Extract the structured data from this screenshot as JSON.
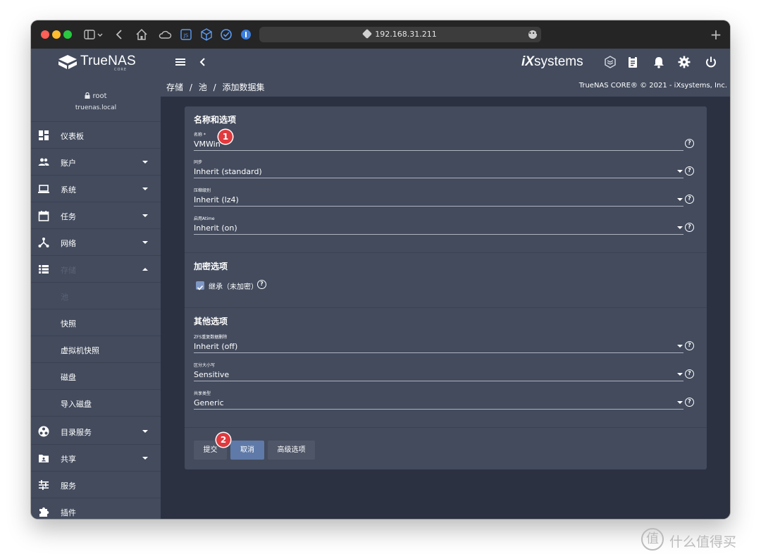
{
  "browser": {
    "address": "192.168.31.211",
    "new_tab": "+"
  },
  "header": {
    "logo_text": "TrueNAS",
    "logo_sub": "CORE",
    "vendor_logo_prefix": "iX",
    "vendor_logo_suffix": "systems"
  },
  "sidebar": {
    "user": "root",
    "host": "truenas.local",
    "items": [
      {
        "label": "仪表板",
        "icon": "dashboard-icon"
      },
      {
        "label": "账户",
        "icon": "people-icon"
      },
      {
        "label": "系统",
        "icon": "laptop-icon"
      },
      {
        "label": "任务",
        "icon": "calendar-icon"
      },
      {
        "label": "网络",
        "icon": "network-icon"
      },
      {
        "label": "存储",
        "icon": "list-icon"
      },
      {
        "label": "池"
      },
      {
        "label": "快照"
      },
      {
        "label": "虚拟机快照"
      },
      {
        "label": "磁盘"
      },
      {
        "label": "导入磁盘"
      },
      {
        "label": "目录服务",
        "icon": "directory-icon"
      },
      {
        "label": "共享",
        "icon": "folder-share-icon"
      },
      {
        "label": "服务",
        "icon": "sliders-icon"
      },
      {
        "label": "插件",
        "icon": "puzzle-icon"
      }
    ]
  },
  "breadcrumb": {
    "level1": "存储",
    "level2": "池",
    "level3": "添加数据集",
    "sep": "/"
  },
  "copyright": "TrueNAS CORE® © 2021 - iXsystems, Inc.",
  "form": {
    "section1_title": "名称和选项",
    "name_label": "名称 *",
    "name_value": "VMWin",
    "sync_label": "同步",
    "sync_value": "Inherit (standard)",
    "compression_label": "压缩级别",
    "compression_value": "Inherit (lz4)",
    "atime_label": "启用Atime",
    "atime_value": "Inherit (on)",
    "section2_title": "加密选项",
    "encryption_checkbox_label": "继承（未加密）",
    "encryption_checked": true,
    "section3_title": "其他选项",
    "dedup_label": "ZFS重复数据删除",
    "dedup_value": "Inherit (off)",
    "case_label": "区分大小写",
    "case_value": "Sensitive",
    "share_label": "共享类型",
    "share_value": "Generic",
    "help": "?",
    "submit": "提交",
    "cancel": "取消",
    "advanced": "高级选项"
  },
  "annotations": {
    "badge1": "1",
    "badge2": "2"
  },
  "watermark": {
    "logo": "值",
    "text": "什么值得买"
  }
}
